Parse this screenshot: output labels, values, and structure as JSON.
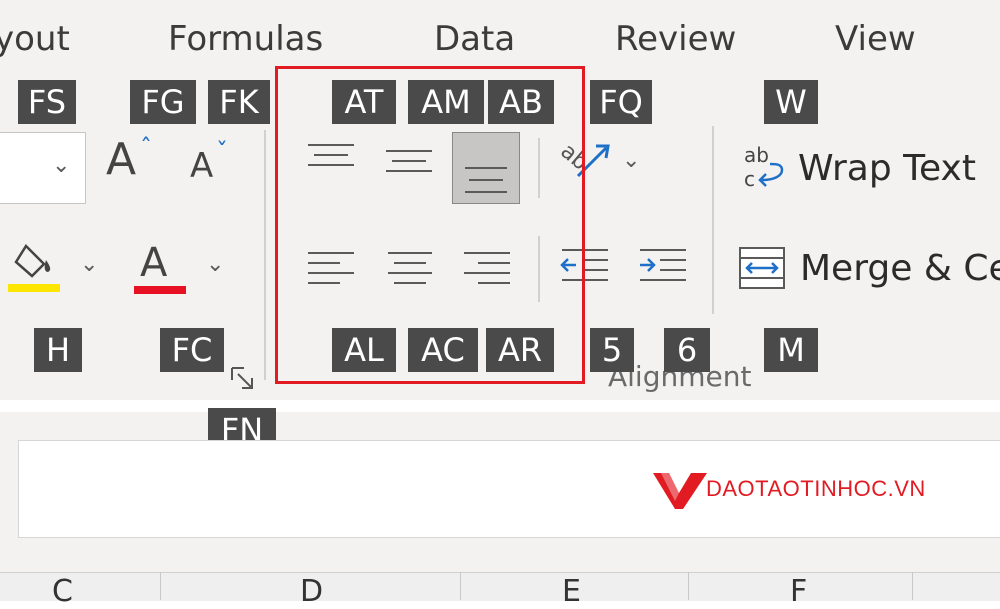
{
  "tabs": [
    {
      "label": "yout"
    },
    {
      "label": "Formulas"
    },
    {
      "label": "Data"
    },
    {
      "label": "Review"
    },
    {
      "label": "View"
    }
  ],
  "keytips": {
    "fs": "FS",
    "fg": "FG",
    "fk": "FK",
    "at": "AT",
    "am": "AM",
    "ab": "AB",
    "fq": "FQ",
    "w": "W",
    "h": "H",
    "fc": "FC",
    "al": "AL",
    "ac": "AC",
    "ar": "AR",
    "five": "5",
    "six": "6",
    "m": "M",
    "fn": "FN"
  },
  "font_group": {
    "grow_label": "A",
    "shrink_label": "A",
    "font_color_label": "A",
    "fill_color": "#ffe600",
    "font_color": "#e81123"
  },
  "alignment_group": {
    "wrap_text_label": "Wrap Text",
    "wrap_text_icon_label": "ab\nc",
    "merge_label": "Merge & Ce",
    "group_name": "Alignment",
    "highlight_color": "#e21b23"
  },
  "columns": [
    "C",
    "D",
    "E",
    "F"
  ],
  "watermark": {
    "text": "DAOTAOTINHOC.VN",
    "color": "#e21b23"
  }
}
